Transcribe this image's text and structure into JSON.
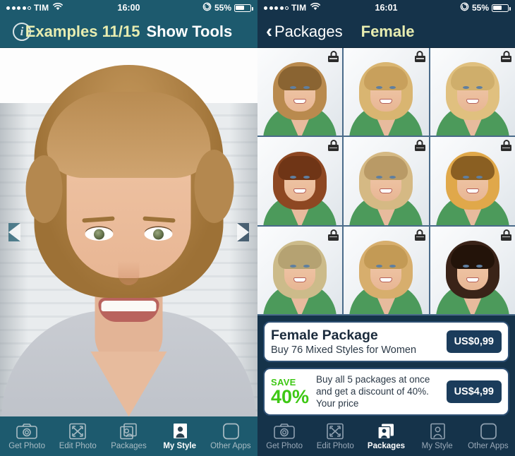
{
  "left_phone": {
    "statusbar": {
      "carrier": "TIM",
      "signal_dots_filled": 4,
      "signal_dots_total": 5,
      "wifi_icon": "wifi-icon",
      "time": "16:00",
      "battery_percent": "55%",
      "battery_level": 55,
      "orientation_lock_icon": "rotation-lock-icon"
    },
    "navbar": {
      "info_button": "i",
      "examples_label": "Examples 11/15",
      "show_tools_label": "Show Tools"
    },
    "photo": {
      "prev_arrow": "prev-arrow",
      "next_arrow": "next-arrow"
    },
    "tabs": [
      {
        "label": "Get Photo",
        "icon": "camera-icon",
        "active": false
      },
      {
        "label": "Edit Photo",
        "icon": "expand-arrows-icon",
        "active": false
      },
      {
        "label": "Packages",
        "icon": "stacked-photos-icon",
        "active": false
      },
      {
        "label": "My Style",
        "icon": "person-frame-icon",
        "active": true
      },
      {
        "label": "Other Apps",
        "icon": "rounded-square-icon",
        "active": false
      }
    ]
  },
  "right_phone": {
    "statusbar": {
      "carrier": "TIM",
      "signal_dots_filled": 4,
      "signal_dots_total": 5,
      "wifi_icon": "wifi-icon",
      "time": "16:01",
      "battery_percent": "55%",
      "battery_level": 55,
      "orientation_lock_icon": "rotation-lock-icon"
    },
    "navbar": {
      "back_icon": "chevron-left-icon",
      "back_label": "Packages",
      "title": "Female"
    },
    "grid": {
      "columns": 3,
      "rows": 3,
      "lock_icon": "lock-icon",
      "items": [
        {
          "hair_color": "#b98a4e",
          "fringe_color": "#8a6432",
          "locked": true
        },
        {
          "hair_color": "#d9b571",
          "fringe_color": "#c8a05c",
          "locked": true
        },
        {
          "hair_color": "#e0c07f",
          "fringe_color": "#cfae6b",
          "locked": true
        },
        {
          "hair_color": "#8d4722",
          "fringe_color": "#6f3516",
          "locked": true
        },
        {
          "hair_color": "#d5b984",
          "fringe_color": "#b99a66",
          "locked": true
        },
        {
          "hair_color": "#e0a84a",
          "fringe_color": "#8a5f22",
          "locked": true
        },
        {
          "hair_color": "#ccbb8a",
          "fringe_color": "#b5a272",
          "locked": true
        },
        {
          "hair_color": "#d7ae6d",
          "fringe_color": "#c39a55",
          "locked": true
        },
        {
          "hair_color": "#3a2318",
          "fringe_color": "#231309",
          "locked": true
        }
      ]
    },
    "offers": [
      {
        "title": "Female Package",
        "subtitle": "Buy 76 Mixed Styles for Women",
        "price": "US$0,99"
      },
      {
        "save_word": "SAVE",
        "save_percent": "40%",
        "description": "Buy all 5 packages at once and get a discount of 40%. Your price",
        "price": "US$4,99"
      }
    ],
    "tabs": [
      {
        "label": "Get Photo",
        "icon": "camera-icon",
        "active": false
      },
      {
        "label": "Edit Photo",
        "icon": "expand-arrows-icon",
        "active": false
      },
      {
        "label": "Packages",
        "icon": "stacked-photos-icon",
        "active": true
      },
      {
        "label": "My Style",
        "icon": "person-frame-icon",
        "active": false
      },
      {
        "label": "Other Apps",
        "icon": "rounded-square-icon",
        "active": false
      }
    ]
  },
  "colors": {
    "left_chrome": "#1d5a6e",
    "right_chrome": "#15334a",
    "accent_yellow": "#e8edb0",
    "save_green": "#3ec814",
    "price_button": "#1b3c5b",
    "card_border": "#2d4f73"
  }
}
